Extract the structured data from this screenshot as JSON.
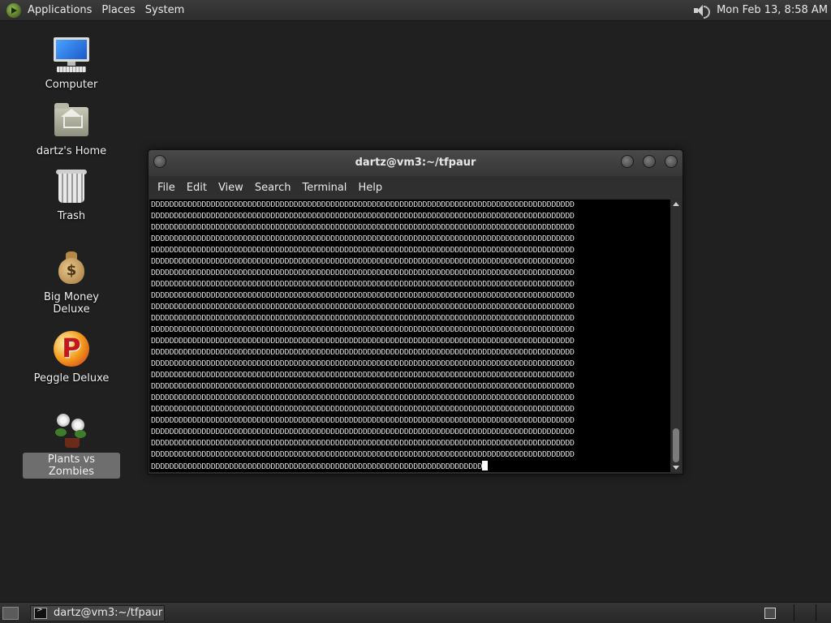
{
  "top_panel": {
    "menus": [
      "Applications",
      "Places",
      "System"
    ],
    "clock": "Mon Feb 13,  8:58 AM"
  },
  "desktop": {
    "icons": [
      {
        "label": "Computer",
        "icon": "computer-icon"
      },
      {
        "label": "dartz's Home",
        "icon": "home-folder-icon"
      },
      {
        "label": "Trash",
        "icon": "trash-icon"
      },
      {
        "label": "Big Money Deluxe",
        "icon": "money-bag-icon"
      },
      {
        "label": "Peggle Deluxe",
        "icon": "peggle-icon"
      },
      {
        "label": "Plants vs Zombies",
        "icon": "plants-vs-zombies-icon",
        "selected": true
      }
    ]
  },
  "terminal": {
    "title": "dartz@vm3:~/tfpaur",
    "menu": [
      "File",
      "Edit",
      "View",
      "Search",
      "Terminal",
      "Help"
    ],
    "fill_char": "D",
    "full_lines": 23,
    "chars_per_line": 92,
    "last_line_chars": 72
  },
  "taskbar": {
    "window_button": "dartz@vm3:~/tfpaur"
  }
}
